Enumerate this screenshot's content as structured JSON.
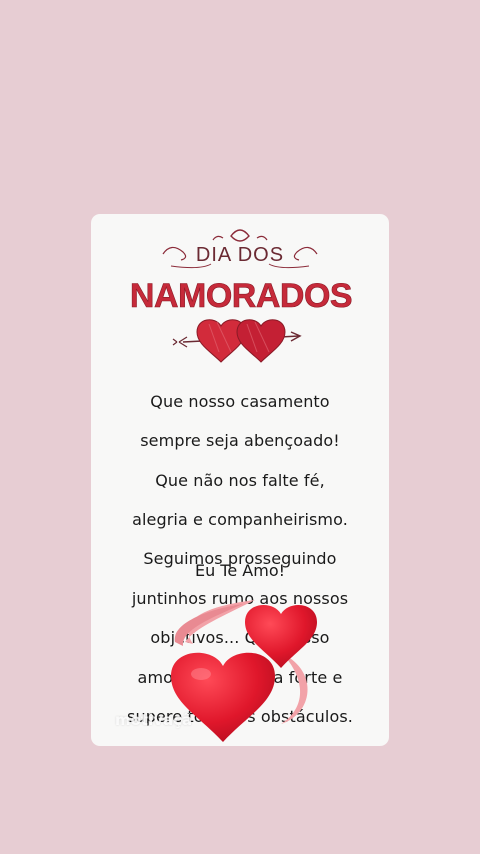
{
  "banner": {
    "line1": "DIA DOS",
    "line2": "NAMORADOS"
  },
  "message": {
    "lines": [
      "Que nosso casamento",
      "sempre seja abençoado!",
      "Que não nos falte fé,",
      "alegria e companheirismo.",
      "Seguimos prosseguindo",
      "juntinhos rumo aos nossos",
      "objetivos... Que nosso",
      "amor sempre seja forte e",
      "supere todos os obstáculos."
    ],
    "closing": "Eu Te Amo!"
  },
  "watermark": "motivaçã",
  "icons": [
    "hearts-arrow-icon",
    "revolving-hearts-icon"
  ],
  "colors": {
    "background": "#e7cdd3",
    "card": "#f8f8f7",
    "heart_red": "#d91c2c",
    "banner_red": "#c62a3a"
  }
}
